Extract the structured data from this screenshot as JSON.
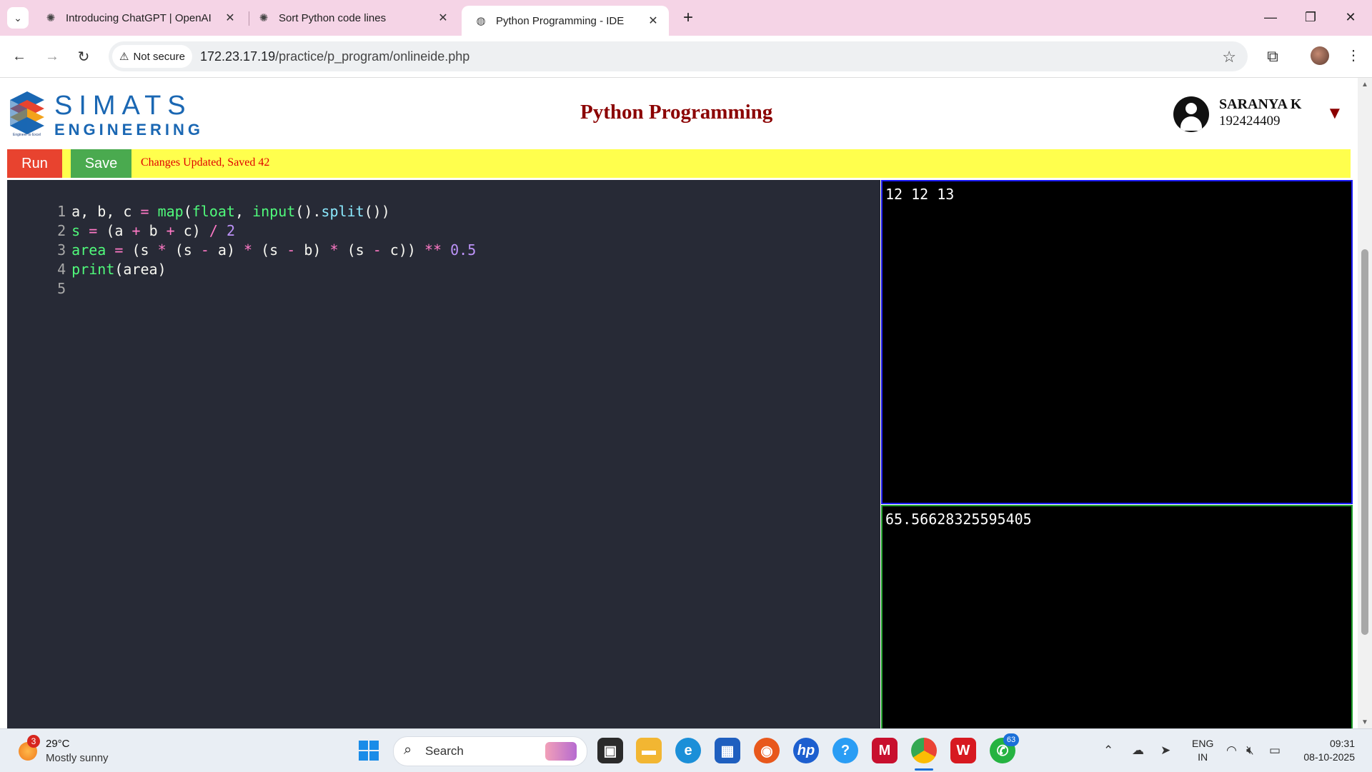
{
  "browser": {
    "tabs": [
      {
        "title": "Introducing ChatGPT | OpenAI",
        "favicon": "openai-icon"
      },
      {
        "title": "Sort Python code lines",
        "favicon": "openai-icon"
      },
      {
        "title": "Python Programming - IDE",
        "favicon": "globe-icon",
        "active": true
      }
    ],
    "security_label": "Not secure",
    "url_host": "172.23.17.19",
    "url_path": "/practice/p_program/onlineide.php"
  },
  "header": {
    "logo_line1": "SIMATS",
    "logo_line2": "ENGINEERING",
    "logo_tagline": "Engineer to Excel",
    "page_title": "Python Programming",
    "user_name": "SARANYA K",
    "user_id": "192424409"
  },
  "toolbar": {
    "run_label": "Run",
    "save_label": "Save",
    "status_message": "Changes Updated, Saved 42"
  },
  "editor": {
    "line_numbers": [
      "1",
      "2",
      "3",
      "4",
      "5"
    ],
    "lines": [
      "a, b, c = map(float, input().split())",
      "s = (a + b + c) / 2",
      "area = (s * (s - a) * (s - b) * (s - c)) ** 0.5",
      "print(area)",
      ""
    ]
  },
  "input_pane": {
    "text": "12 12 13"
  },
  "output_pane": {
    "text": "65.56628325595405"
  },
  "taskbar": {
    "weather_temp": "29°C",
    "weather_condition": "Mostly sunny",
    "weather_badge": "3",
    "search_placeholder": "Search",
    "whatsapp_badge": "63",
    "lang_line1": "ENG",
    "lang_line2": "IN",
    "time": "09:31",
    "date": "08-10-2025"
  },
  "colors": {
    "tabbar_bg": "#f5d4e6",
    "title_red": "#8b0000",
    "run_red": "#e8432f",
    "save_green": "#4aaa4f",
    "toolbar_yellow": "#ffff4d",
    "editor_bg": "#272a36",
    "input_border": "#1a1aff",
    "output_border": "#1e9e2a"
  }
}
